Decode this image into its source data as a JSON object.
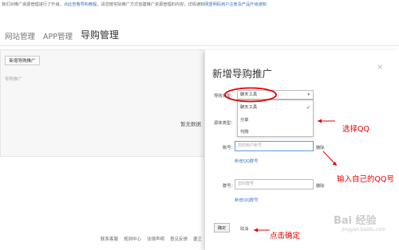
{
  "notice": {
    "text": "我们对推广资源管理进行了升级，",
    "link1": "点此查看导购教程",
    "text2": "，请您按实际推广方式创建推广资源管理的内容，详情通知",
    "link2": "网盟明码用户注册及产品升级通知"
  },
  "tabs": [
    "网站管理",
    "APP管理",
    "导购管理"
  ],
  "panel": {
    "add_button": "新增导购推广",
    "subtext": "导购推广",
    "empty_text": "暂无数据"
  },
  "footer": [
    "联系客服",
    "规则中心",
    "法律声明",
    "意见反馈",
    "厦正"
  ],
  "modal": {
    "title": "新增导购推广",
    "close": "×",
    "field_type_label": "导购类型：",
    "select_value": "聊天工具",
    "options": [
      "聊天工具",
      "分享",
      "代购"
    ],
    "check": "✓",
    "label_source_type": "源体类型：",
    "label_account": "账号：",
    "account_placeholder": "您的用户账号",
    "delete1": "删除",
    "add_qq": "新增QQ群号",
    "label_group": "群号：",
    "group_placeholder": "您的群号",
    "delete2": "删除",
    "add_group": "新增QQ群号",
    "ok": "确定",
    "cancel": "取消"
  },
  "annotations": {
    "select_qq": "选择QQ",
    "input_qq": "输入自己的QQ号",
    "click_ok": "点击确定"
  },
  "watermark": {
    "main": "Bai 经验",
    "sub": "jingyan.baidu.com"
  },
  "colors": {
    "accent": "#e60000",
    "link": "#3b73c4"
  }
}
